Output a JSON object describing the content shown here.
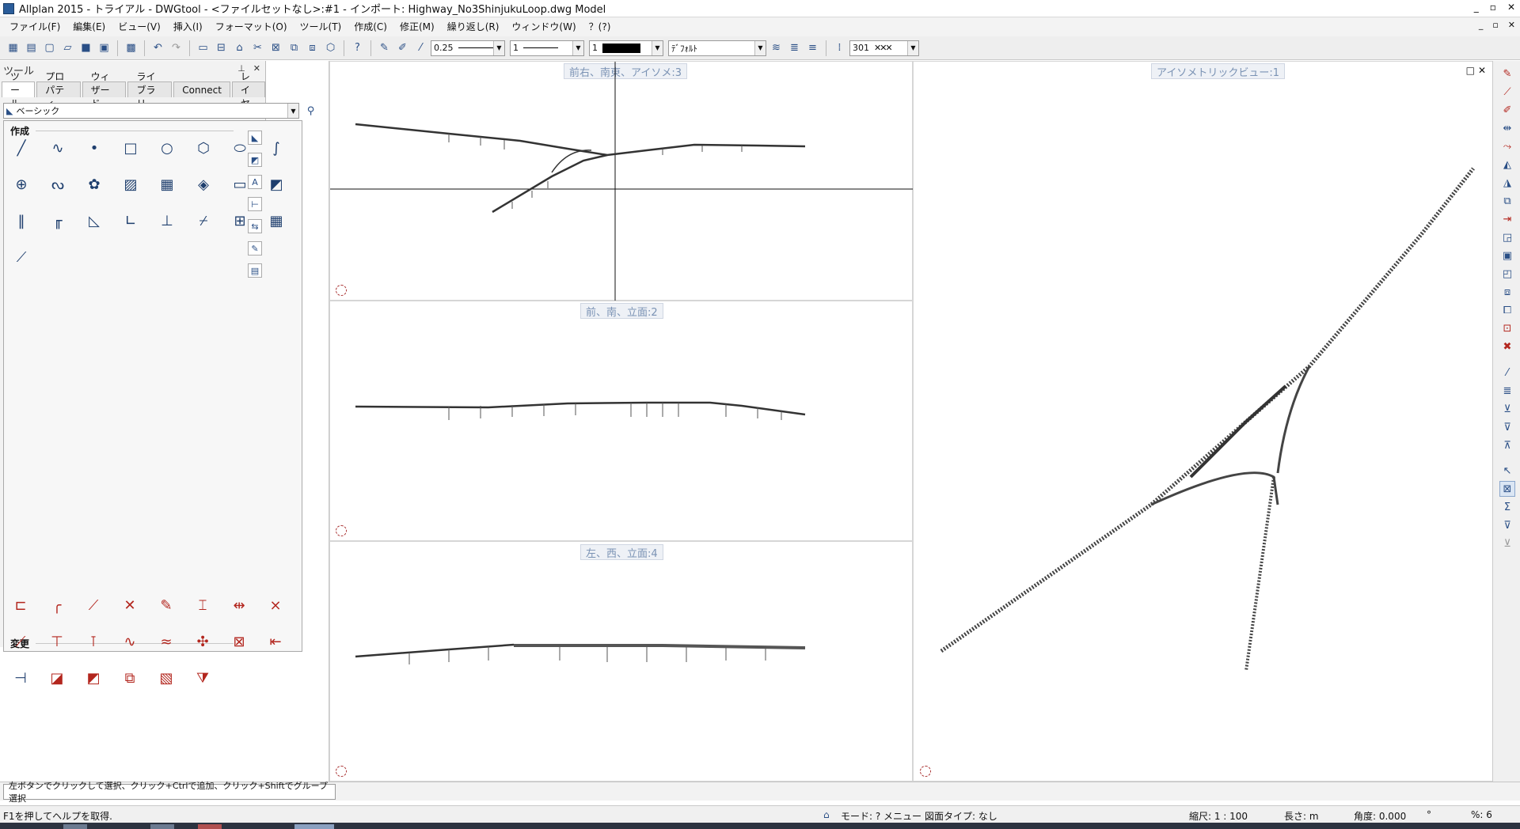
{
  "window": {
    "title": "Allplan 2015 - トライアル - DWGtool - <ファイルセットなし>:#1 - インポート: Highway_No3ShinjukuLoop.dwg Model"
  },
  "menu": [
    "ファイル(F)",
    "編集(E)",
    "ビュー(V)",
    "挿入(I)",
    "フォーマット(O)",
    "ツール(T)",
    "作成(C)",
    "修正(M)",
    "繰り返し(R)",
    "ウィンドウ(W)",
    "？(?)"
  ],
  "toolbar": {
    "pen_thickness": "0.25",
    "line_type": "1",
    "line_color": "1",
    "layer": "ﾃﾞﾌｫﾙﾄ",
    "pattern_number": "301"
  },
  "palette": {
    "title": "ツール",
    "tabs": [
      "ツール",
      "プロパティ",
      "ウィザード",
      "ライブラリ",
      "Connect",
      "レイヤ"
    ],
    "active_tab": "ツール",
    "module": "ベーシック",
    "groups": {
      "create": "作成",
      "modify": "変更"
    }
  },
  "views": {
    "view3": "前右、南東、アイソメ:3",
    "view2": "前、南、立面:2",
    "view4": "左、西、立面:4",
    "view1": "アイソメトリックビュー:1"
  },
  "dialog_line": "左ボタンでクリックして選択、クリック+Ctrlで追加、クリック+Shiftでグループ選択",
  "status": {
    "help": "F1を押してヘルプを取得.",
    "mode": "モード: ? メニュー",
    "drawing_type": "図面タイプ: なし",
    "scale": "縮尺: 1 : 100",
    "length": "長さ: m",
    "angle": "角度: 0.000",
    "angle_unit": "°",
    "percent": "%: 6"
  },
  "colors": {
    "accent": "#2a4f86",
    "modify_red": "#b3261e",
    "view_label": "#7a92b4"
  }
}
